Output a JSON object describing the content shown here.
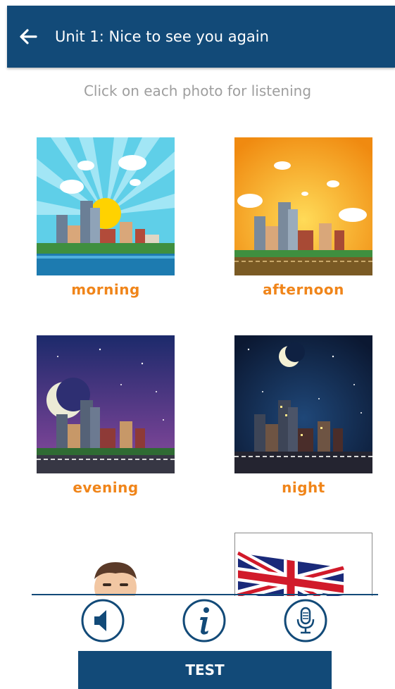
{
  "header": {
    "title": "Unit 1: Nice to see you again",
    "back_icon": "arrow-left-icon"
  },
  "instruction": "Click on each photo for listening",
  "cards": [
    {
      "label": "morning"
    },
    {
      "label": "afternoon"
    },
    {
      "label": "evening"
    },
    {
      "label": "night"
    }
  ],
  "bottom_bar": {
    "speaker_icon": "speaker-icon",
    "info_icon": "info-icon",
    "mic_icon": "microphone-icon",
    "test_label": "TEST"
  },
  "colors": {
    "primary": "#124a78",
    "accent": "#f0851a",
    "muted_text": "#9e9e9e"
  }
}
